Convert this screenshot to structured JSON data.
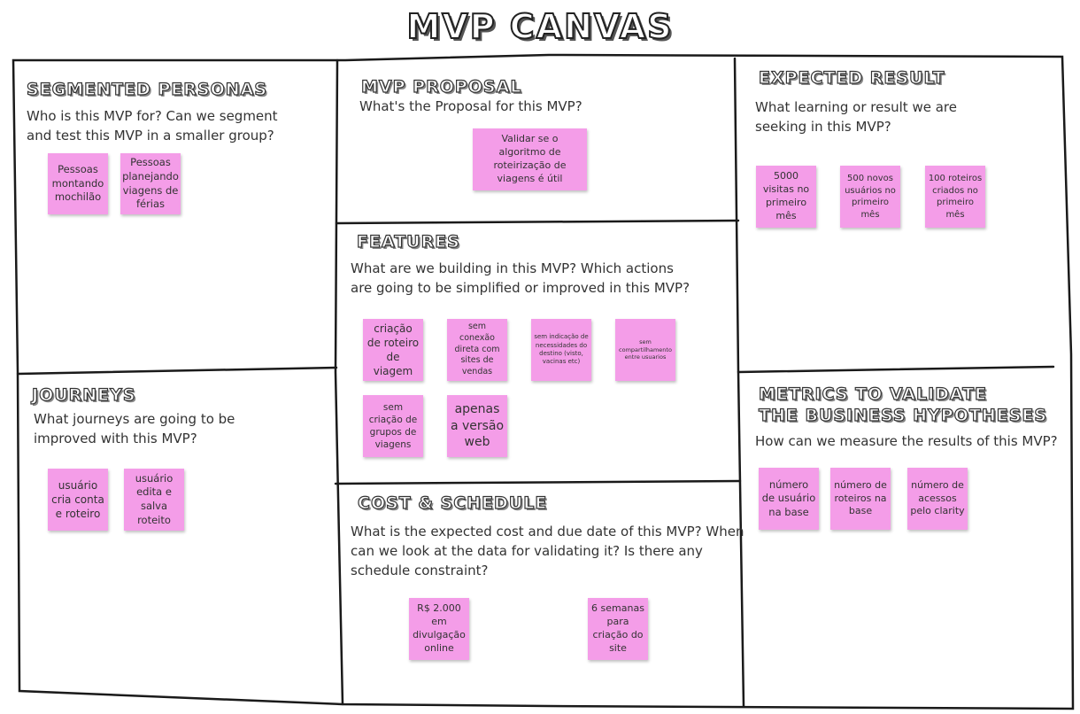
{
  "canvas_title": "MVP CANVAS",
  "sections": {
    "personas": {
      "title": "Segmented Personas",
      "question": "Who is this MVP for? Can we segment\nand test this MVP in a smaller group?",
      "notes": [
        "Pessoas montando mochilão",
        "Pessoas planejando viagens de férias"
      ]
    },
    "journeys": {
      "title": "Journeys",
      "question": "What journeys are going to be\nimproved with this MVP?",
      "notes": [
        "usuário cria conta e roteiro",
        "usuário edita e salva roteito"
      ]
    },
    "proposal": {
      "title": "MVP Proposal",
      "question": "What's the Proposal for this MVP?",
      "notes": [
        "Validar se o algoritmo de roteirização de viagens é útil"
      ]
    },
    "features": {
      "title": "Features",
      "question": "What are we building in this MVP? Which actions\nare going to be simplified or improved in this MVP?",
      "notes": [
        "criação de roteiro de viagem",
        "sem conexão direta com sites de vendas",
        "sem indicação de necessidades do destino (visto, vacinas etc)",
        "sem compartilhamento entre usuarios",
        "sem criação de grupos de viagens",
        "apenas a versão web"
      ]
    },
    "cost": {
      "title": "Cost & Schedule",
      "question": "What is the expected cost and due date of this MVP? When\ncan we look at the data for validating it? Is there any\nschedule constraint?",
      "notes": [
        "R$ 2.000 em divulgação online",
        "6 semanas para criação do site"
      ]
    },
    "result": {
      "title": "Expected Result",
      "question": "What learning or result we are\nseeking in this MVP?",
      "notes": [
        "5000 visitas no primeiro mês",
        "500 novos usuários no primeiro mês",
        "100 roteiros criados no primeiro mês"
      ]
    },
    "metrics": {
      "title_line1": "Metrics to validate",
      "title_line2": "the business hypotheses",
      "question": "How can we measure the results of this MVP?",
      "notes": [
        "número de usuário na base",
        "número de roteiros na base",
        "número de acessos pelo clarity"
      ]
    }
  },
  "colors": {
    "sticky_note": "#f49de8",
    "line": "#1a1a1a",
    "text": "#333333"
  }
}
